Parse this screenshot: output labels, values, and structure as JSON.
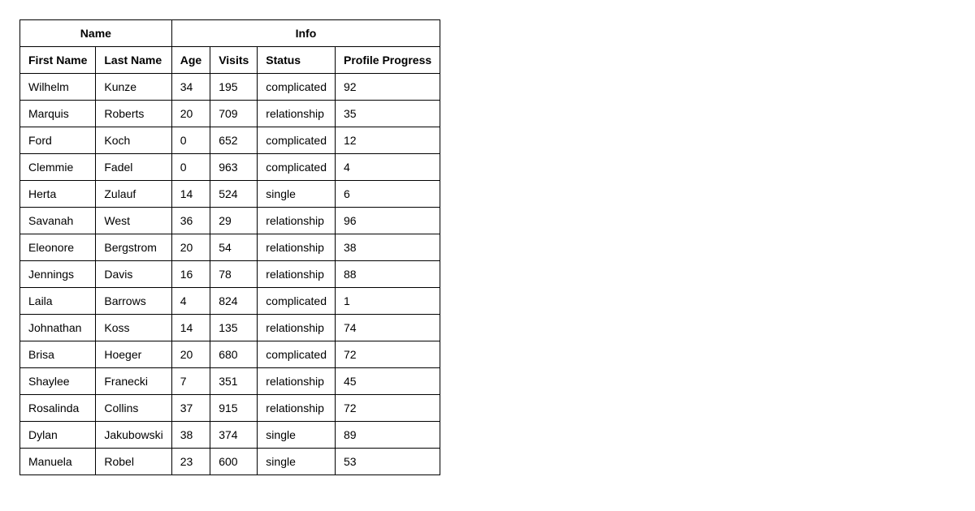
{
  "table": {
    "group_headers": {
      "name": "Name",
      "info": "Info"
    },
    "columns": {
      "first_name": "First Name",
      "last_name": "Last Name",
      "age": "Age",
      "visits": "Visits",
      "status": "Status",
      "progress": "Profile Progress"
    },
    "rows": [
      {
        "first_name": "Wilhelm",
        "last_name": "Kunze",
        "age": 34,
        "visits": 195,
        "status": "complicated",
        "progress": 92
      },
      {
        "first_name": "Marquis",
        "last_name": "Roberts",
        "age": 20,
        "visits": 709,
        "status": "relationship",
        "progress": 35
      },
      {
        "first_name": "Ford",
        "last_name": "Koch",
        "age": 0,
        "visits": 652,
        "status": "complicated",
        "progress": 12
      },
      {
        "first_name": "Clemmie",
        "last_name": "Fadel",
        "age": 0,
        "visits": 963,
        "status": "complicated",
        "progress": 4
      },
      {
        "first_name": "Herta",
        "last_name": "Zulauf",
        "age": 14,
        "visits": 524,
        "status": "single",
        "progress": 6
      },
      {
        "first_name": "Savanah",
        "last_name": "West",
        "age": 36,
        "visits": 29,
        "status": "relationship",
        "progress": 96
      },
      {
        "first_name": "Eleonore",
        "last_name": "Bergstrom",
        "age": 20,
        "visits": 54,
        "status": "relationship",
        "progress": 38
      },
      {
        "first_name": "Jennings",
        "last_name": "Davis",
        "age": 16,
        "visits": 78,
        "status": "relationship",
        "progress": 88
      },
      {
        "first_name": "Laila",
        "last_name": "Barrows",
        "age": 4,
        "visits": 824,
        "status": "complicated",
        "progress": 1
      },
      {
        "first_name": "Johnathan",
        "last_name": "Koss",
        "age": 14,
        "visits": 135,
        "status": "relationship",
        "progress": 74
      },
      {
        "first_name": "Brisa",
        "last_name": "Hoeger",
        "age": 20,
        "visits": 680,
        "status": "complicated",
        "progress": 72
      },
      {
        "first_name": "Shaylee",
        "last_name": "Franecki",
        "age": 7,
        "visits": 351,
        "status": "relationship",
        "progress": 45
      },
      {
        "first_name": "Rosalinda",
        "last_name": "Collins",
        "age": 37,
        "visits": 915,
        "status": "relationship",
        "progress": 72
      },
      {
        "first_name": "Dylan",
        "last_name": "Jakubowski",
        "age": 38,
        "visits": 374,
        "status": "single",
        "progress": 89
      },
      {
        "first_name": "Manuela",
        "last_name": "Robel",
        "age": 23,
        "visits": 600,
        "status": "single",
        "progress": 53
      }
    ]
  }
}
